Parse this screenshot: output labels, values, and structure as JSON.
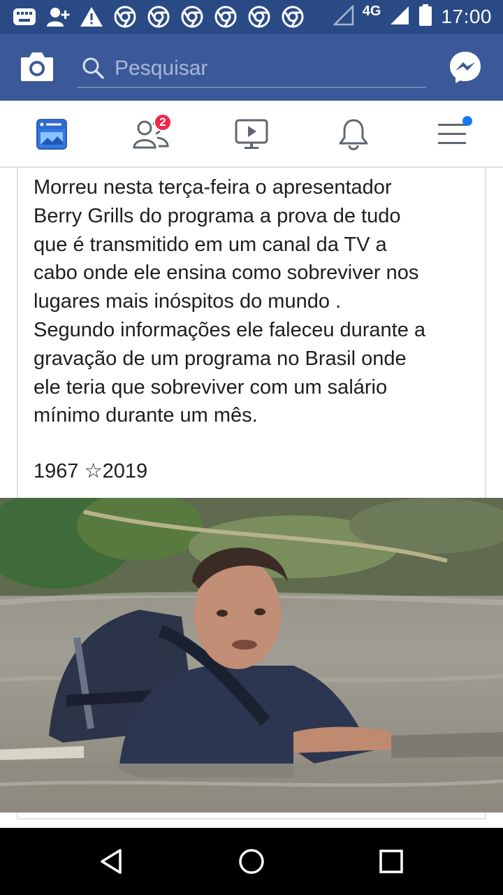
{
  "status_bar": {
    "network": "4G",
    "time": "17:00",
    "icons": [
      "keyboard-icon",
      "add-contact-icon",
      "warning-icon",
      "chrome-icon",
      "chrome-icon",
      "chrome-icon",
      "chrome-icon",
      "chrome-icon",
      "chrome-icon",
      "signal-empty-icon",
      "signal-icon",
      "battery-icon"
    ]
  },
  "header": {
    "search_placeholder": "Pesquisar",
    "icons": [
      "camera-icon",
      "search-icon",
      "messenger-icon"
    ],
    "brand_color": "#3b5998"
  },
  "tabs": [
    {
      "name": "news-feed",
      "icon": "news-feed-icon"
    },
    {
      "name": "friends",
      "icon": "friends-icon",
      "badge": "2"
    },
    {
      "name": "watch",
      "icon": "video-icon"
    },
    {
      "name": "notifications",
      "icon": "bell-icon"
    },
    {
      "name": "menu",
      "icon": "menu-icon"
    }
  ],
  "post": {
    "text": "Morreu nesta terça-feira o apresentador\nBerry Grills do programa a prova de tudo\nque é  transmitido em um canal da TV a\ncabo onde ele  ensina como sobreviver nos\nlugares mais inóspitos do mundo .\nSegundo informações ele faleceu durante a\ngravação de um programa no Brasil onde\nele teria que sobreviver com um salário\nmínimo durante um mês.",
    "dates": "1967 ☆2019",
    "photo": "man-in-river-with-backpack"
  },
  "nav_bar": {
    "icons": [
      "back-icon",
      "home-icon",
      "recent-apps-icon"
    ]
  }
}
